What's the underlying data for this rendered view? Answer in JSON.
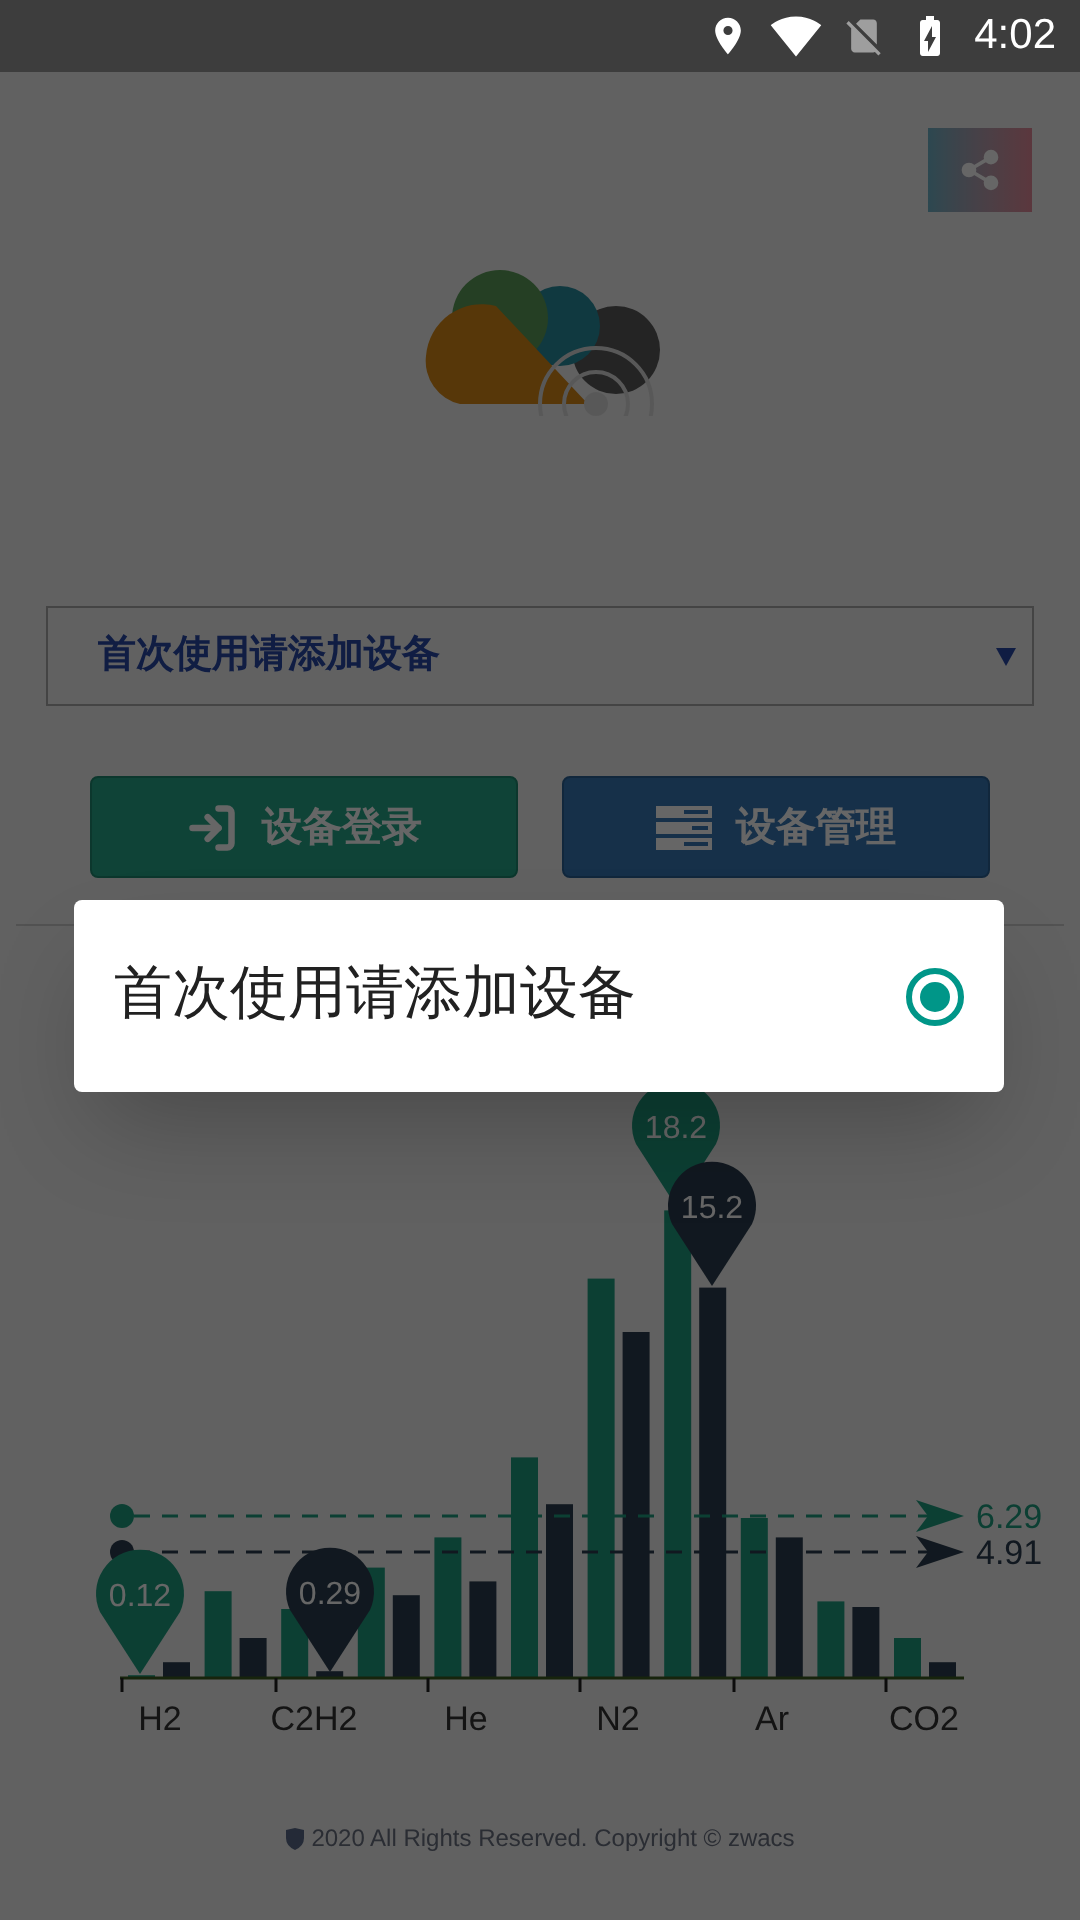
{
  "status_bar": {
    "time": "4:02"
  },
  "device_select": {
    "value": "首次使用请添加设备"
  },
  "buttons": [
    {
      "label": "设备登录",
      "kind": "login"
    },
    {
      "label": "设备管理",
      "kind": "manage"
    }
  ],
  "chart": {
    "x_labels": [
      "H2",
      "C2H2",
      "He",
      "N2",
      "Ar",
      "CO2"
    ],
    "average_lines": [
      {
        "label": "6.29",
        "kind": "green"
      },
      {
        "label": "4.91",
        "kind": "dark"
      }
    ],
    "pins": [
      {
        "label": "0.12",
        "kind": "green"
      },
      {
        "label": "0.29",
        "kind": "dark"
      },
      {
        "label": "18.2",
        "kind": "green"
      },
      {
        "label": "15.2",
        "kind": "dark"
      }
    ]
  },
  "footer": "2020 All Rights Reserved. Copyright © zwacs",
  "dialog": {
    "options": [
      {
        "label": "首次使用请添加设备",
        "selected": true
      }
    ]
  }
}
